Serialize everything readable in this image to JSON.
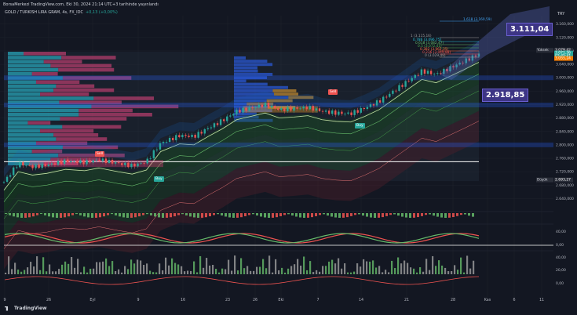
{
  "header": {
    "title": "BorsaMerkezi TradingView.com, Eki 30, 2024 21:14 UTC+3 tarihinde yayınlandı",
    "symbol": "GOLD / TURKISH LIRA GRAM, 4s, FX_IDC",
    "change": "+0,13 (+0,00%)"
  },
  "footer": {
    "brand": "TradingView"
  },
  "labels": {
    "big_top": "3.111,04",
    "big_mid": "2.918,85",
    "high_label": "Yüksek",
    "high_value": "3.079,42",
    "low_label": "Düşük",
    "low_value": "2.693,27",
    "price_green": "3.071,36",
    "countdown": "02:45:41",
    "price_orange": "3.055,24",
    "currency": "TRY",
    "sell": "Sell",
    "buy": "Buy"
  },
  "fib_labels": [
    {
      "text": "1.618 (3.160,59)"
    },
    {
      "text": "1 (3.115,16)"
    },
    {
      "text": "0.786 (3.096,75)"
    },
    {
      "text": "0.618 (3.082,47)"
    },
    {
      "text": "0.5 (3.072,41)"
    },
    {
      "text": "0.382 (3.062,35)"
    },
    {
      "text": "0.236 (3.049,88)"
    },
    {
      "text": "0 (3.029,49)"
    }
  ],
  "colors": {
    "background": "#131722",
    "up": "#26a69a",
    "down": "#ef5350",
    "grid": "#1e222d",
    "box": "#3d3585"
  },
  "chart_data": {
    "type": "candlestick",
    "title": "GOLD / TURKISH LIRA GRAM, 4s, FX_IDC",
    "ylim": [
      2620,
      3185
    ],
    "y_ticks": [
      3160,
      3120,
      3080,
      3040,
      3000,
      2960,
      2920,
      2880,
      2840,
      2800,
      2760,
      2720,
      2680,
      2640
    ],
    "x_ticks": [
      "9",
      "26",
      "Eyl",
      "9",
      "16",
      "23",
      "26",
      "Eki",
      "7",
      "14",
      "21",
      "28",
      "Kas",
      "6",
      "11"
    ],
    "series_close_path": [
      {
        "x": 0.0,
        "y": 2690
      },
      {
        "x": 0.03,
        "y": 2745
      },
      {
        "x": 0.06,
        "y": 2735
      },
      {
        "x": 0.09,
        "y": 2740
      },
      {
        "x": 0.13,
        "y": 2752
      },
      {
        "x": 0.17,
        "y": 2748
      },
      {
        "x": 0.2,
        "y": 2756
      },
      {
        "x": 0.24,
        "y": 2745
      },
      {
        "x": 0.27,
        "y": 2738
      },
      {
        "x": 0.3,
        "y": 2750
      },
      {
        "x": 0.33,
        "y": 2805
      },
      {
        "x": 0.37,
        "y": 2828
      },
      {
        "x": 0.4,
        "y": 2825
      },
      {
        "x": 0.43,
        "y": 2850
      },
      {
        "x": 0.46,
        "y": 2873
      },
      {
        "x": 0.49,
        "y": 2900
      },
      {
        "x": 0.52,
        "y": 2910
      },
      {
        "x": 0.55,
        "y": 2920
      },
      {
        "x": 0.58,
        "y": 2905
      },
      {
        "x": 0.61,
        "y": 2908
      },
      {
        "x": 0.64,
        "y": 2912
      },
      {
        "x": 0.67,
        "y": 2900
      },
      {
        "x": 0.7,
        "y": 2895
      },
      {
        "x": 0.73,
        "y": 2893
      },
      {
        "x": 0.76,
        "y": 2910
      },
      {
        "x": 0.79,
        "y": 2930
      },
      {
        "x": 0.82,
        "y": 2960
      },
      {
        "x": 0.85,
        "y": 2990
      },
      {
        "x": 0.88,
        "y": 3020
      },
      {
        "x": 0.91,
        "y": 3010
      },
      {
        "x": 0.94,
        "y": 3030
      },
      {
        "x": 0.97,
        "y": 3050
      },
      {
        "x": 1.0,
        "y": 3071
      }
    ],
    "horizontal_levels": [
      {
        "y": 3000,
        "color": "#2962ff"
      },
      {
        "y": 2918.85,
        "color": "#2962ff"
      },
      {
        "y": 2800,
        "color": "#2962ff"
      },
      {
        "y": 2750,
        "color": "#ffffff"
      }
    ],
    "osc1_ticks": [],
    "osc2_ticks": [
      "40,00",
      "0,00"
    ],
    "osc3_ticks": [
      "40,00",
      "20,00",
      "0,00"
    ]
  }
}
